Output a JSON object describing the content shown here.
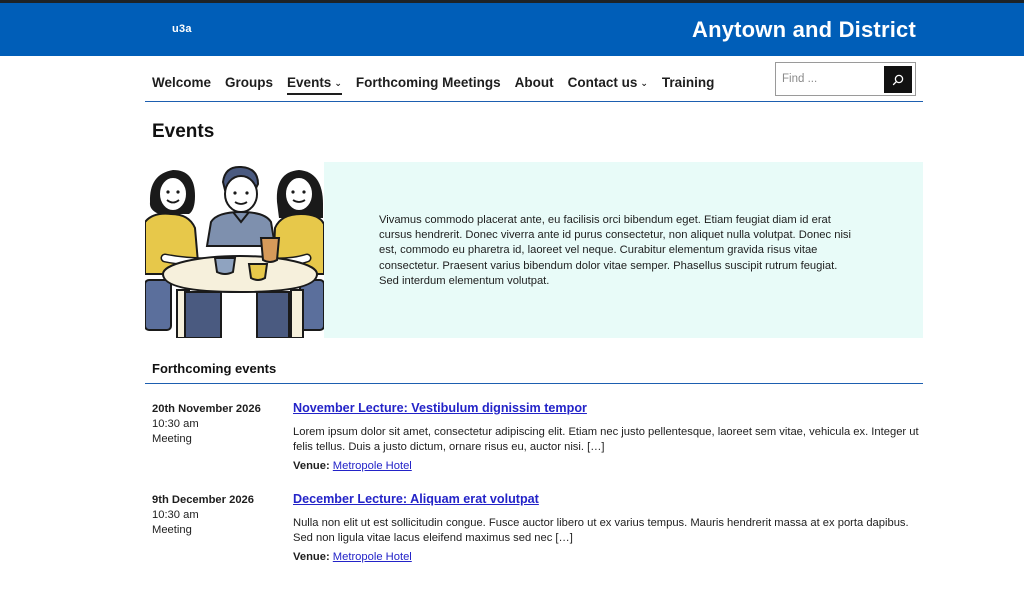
{
  "header": {
    "logo_text": "u3a",
    "site_title": "Anytown and District",
    "banner_color": "#005eb8"
  },
  "nav": {
    "items": [
      {
        "label": "Welcome",
        "has_submenu": false,
        "active": false
      },
      {
        "label": "Groups",
        "has_submenu": false,
        "active": false
      },
      {
        "label": "Events",
        "has_submenu": true,
        "active": true
      },
      {
        "label": "Forthcoming Meetings",
        "has_submenu": false,
        "active": false
      },
      {
        "label": "About",
        "has_submenu": false,
        "active": false
      },
      {
        "label": "Contact us",
        "has_submenu": true,
        "active": false
      },
      {
        "label": "Training",
        "has_submenu": false,
        "active": false
      }
    ],
    "chevron_icon": "chevron-down-icon"
  },
  "search": {
    "placeholder": "Find ...",
    "value": "",
    "button_icon": "search-icon"
  },
  "page": {
    "title": "Events"
  },
  "hero": {
    "image": "people-around-table-illustration",
    "background_color": "#e8fbf8",
    "text": "Vivamus commodo placerat ante, eu facilisis orci bibendum eget. Etiam feugiat diam id erat cursus hendrerit. Donec viverra ante id purus consectetur, non aliquet nulla volutpat. Donec nisi est, commodo eu pharetra id, laoreet vel neque. Curabitur elementum gravida risus vitae consectetur. Praesent varius bibendum dolor vitae semper. Phasellus suscipit rutrum feugiat. Sed interdum elementum volutpat."
  },
  "forthcoming": {
    "section_title": "Forthcoming events",
    "events": [
      {
        "date": "20th November 2026",
        "time": "10:30 am",
        "type": "Meeting",
        "title": "November Lecture: Vestibulum dignissim tempor",
        "description": "Lorem ipsum dolor sit amet, consectetur adipiscing elit. Etiam nec justo pellentesque, laoreet sem vitae, vehicula ex. Integer ut felis tellus. Duis a justo dictum, ornare risus eu, auctor nisi. […]",
        "venue_label": "Venue:",
        "venue": "Metropole Hotel"
      },
      {
        "date": "9th December 2026",
        "time": "10:30 am",
        "type": "Meeting",
        "title": "December Lecture: Aliquam erat volutpat",
        "description": "Nulla non elit ut est sollicitudin congue. Fusce auctor libero ut ex varius tempus. Mauris hendrerit massa at ex porta dapibus. Sed non ligula vitae lacus eleifend maximus sed nec […]",
        "venue_label": "Venue:",
        "venue": "Metropole Hotel"
      }
    ],
    "link_color": "#2323c8"
  }
}
